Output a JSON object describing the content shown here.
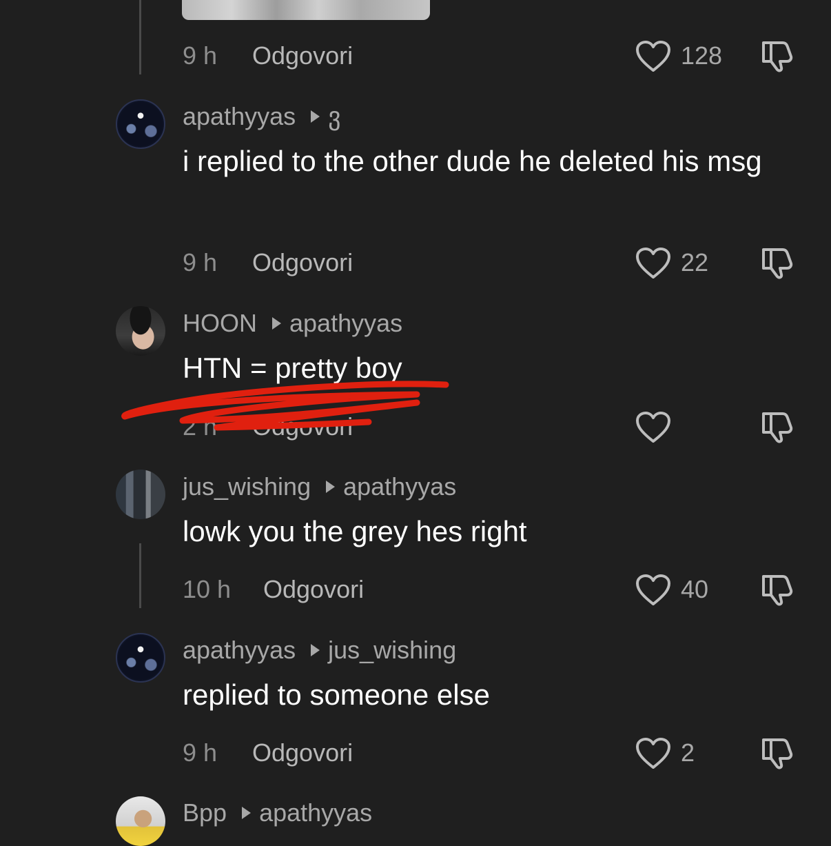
{
  "comments": [
    {
      "time": "9 h",
      "reply_label": "Odgovori",
      "likes": "128"
    },
    {
      "username": "apathyyas",
      "reply_to": "ვ",
      "text": "i replied to the other dude he deleted his msg",
      "time": "9 h",
      "reply_label": "Odgovori",
      "likes": "22"
    },
    {
      "username": "HOON",
      "reply_to": "apathyyas",
      "text": "HTN = pretty boy",
      "time": "2 h",
      "reply_label": "Odgovori",
      "likes": ""
    },
    {
      "username": "jus_wishing",
      "reply_to": "apathyyas",
      "text": "lowk you the grey hes right",
      "time": "10 h",
      "reply_label": "Odgovori",
      "likes": "40"
    },
    {
      "username": "apathyyas",
      "reply_to": "jus_wishing",
      "text": "replied to someone else",
      "time": "9 h",
      "reply_label": "Odgovori",
      "likes": "2"
    },
    {
      "username": "Bpp",
      "reply_to": "apathyyas"
    }
  ],
  "icons": {
    "like": "heart-outline-icon",
    "dislike": "thumbs-down-outline-icon",
    "reply_arrow": "caret-right-icon"
  },
  "colors": {
    "background": "#1f1f1f",
    "username": "#a8a8a8",
    "text": "#ffffff",
    "timestamp": "#8e8e8e",
    "scribble": "#e0200f"
  }
}
